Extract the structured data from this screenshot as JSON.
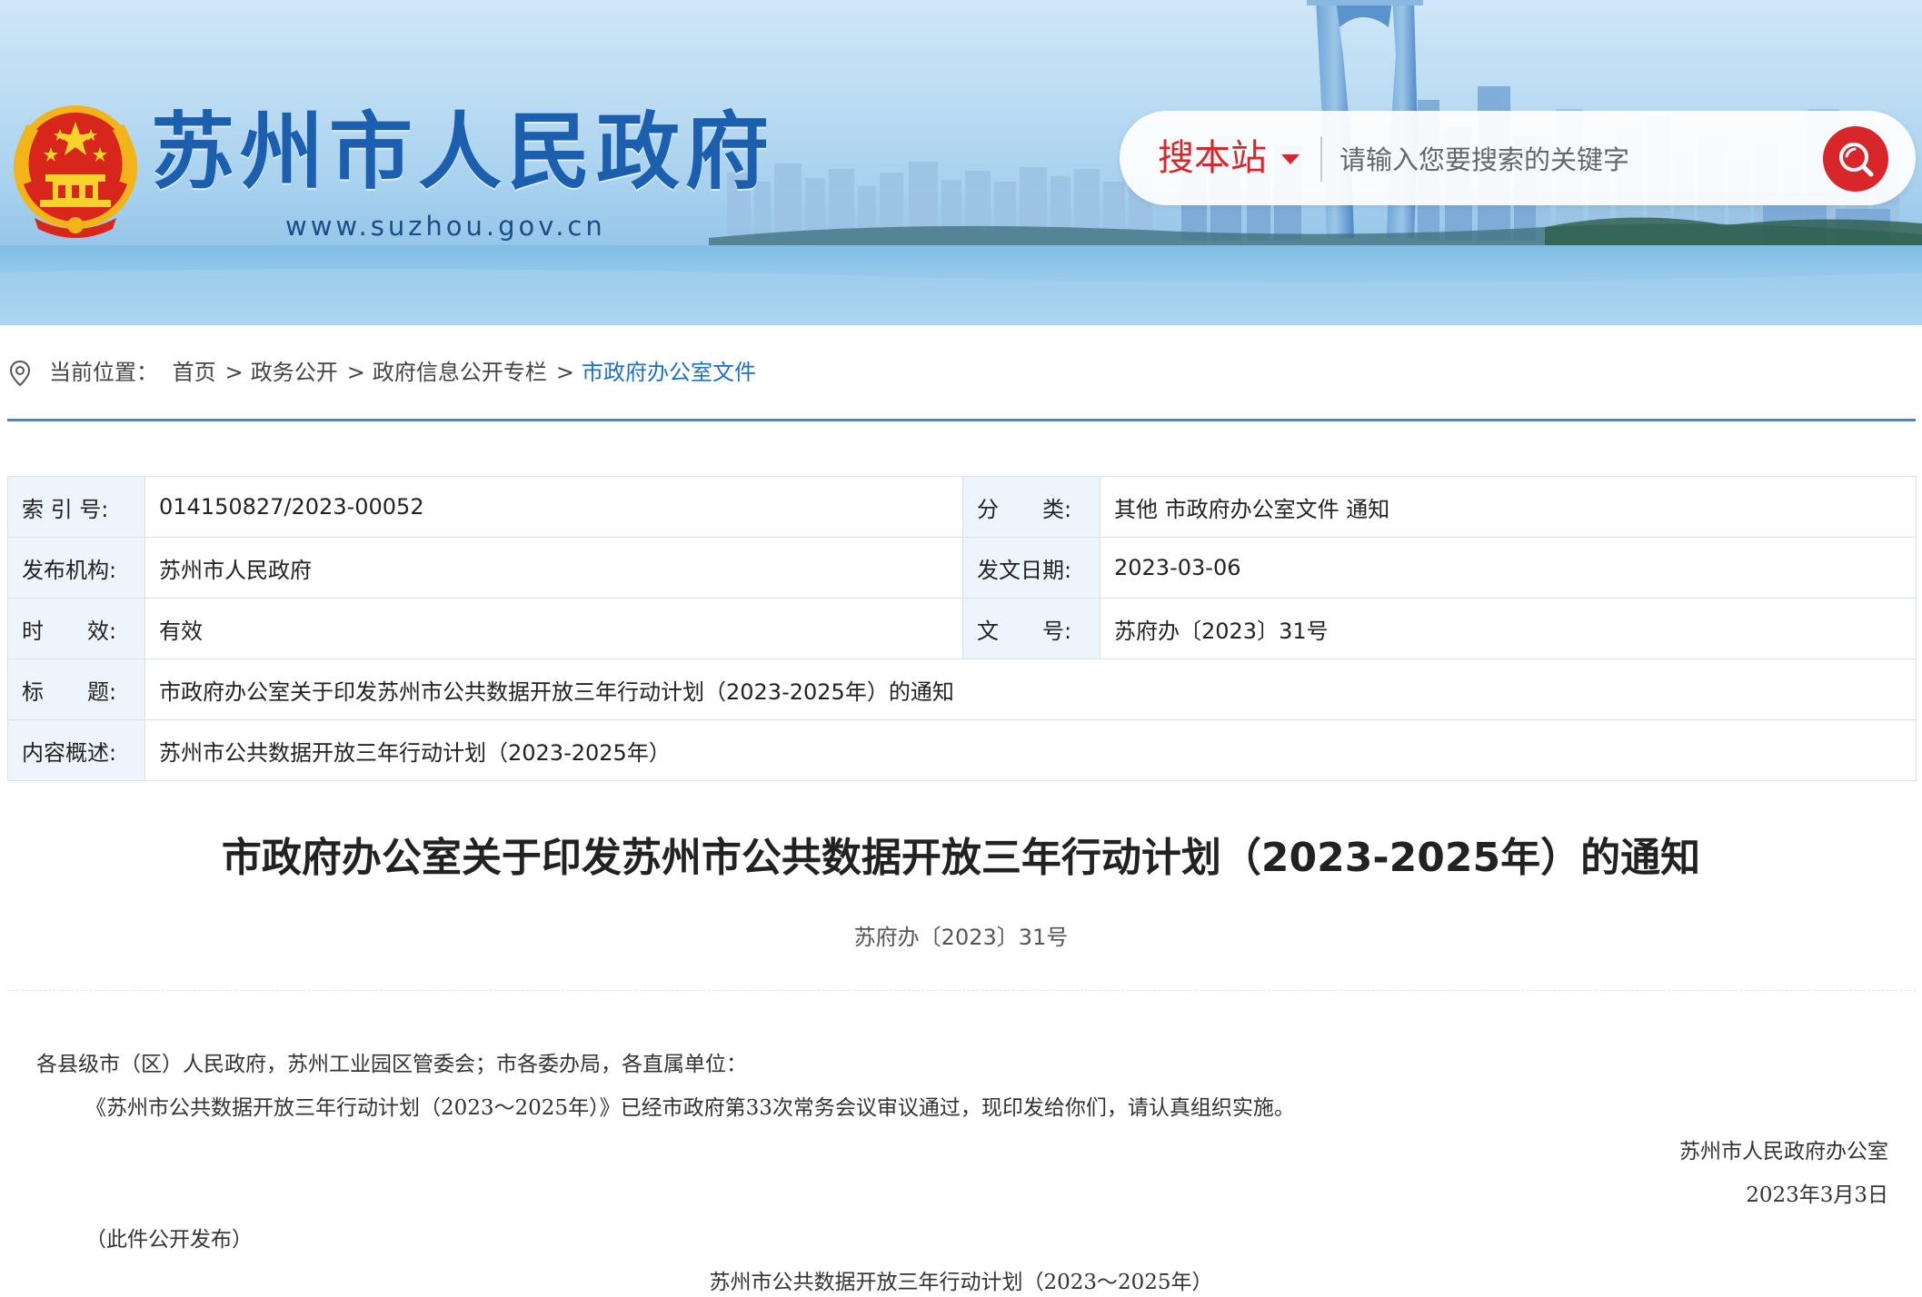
{
  "header": {
    "site_title": "苏州市人民政府",
    "site_url": "www.suzhou.gov.cn",
    "search": {
      "scope_label": "搜本站",
      "placeholder": "请输入您要搜索的关键字"
    }
  },
  "breadcrumb": {
    "prefix": "当前位置：",
    "items": [
      "首页",
      "政务公开",
      "政府信息公开专栏"
    ],
    "separator": ">",
    "current": "市政府办公室文件"
  },
  "info_table": {
    "index_no_label": "索 引 号:",
    "index_no": "014150827/2023-00052",
    "category_label": "分　　类:",
    "category": "其他 市政府办公室文件 通知",
    "publisher_label": "发布机构:",
    "publisher": "苏州市人民政府",
    "issue_date_label": "发文日期:",
    "issue_date": "2023-03-06",
    "validity_label": "时　　效:",
    "validity": "有效",
    "doc_no_label": "文　　号:",
    "doc_no": "苏府办〔2023〕31号",
    "title_label": "标　　题:",
    "title": "市政府办公室关于印发苏州市公共数据开放三年行动计划（2023-2025年）的通知",
    "summary_label": "内容概述:",
    "summary": "苏州市公共数据开放三年行动计划（2023-2025年）"
  },
  "article": {
    "title": "市政府办公室关于印发苏州市公共数据开放三年行动计划（2023-2025年）的通知",
    "doc_no": "苏府办〔2023〕31号",
    "addressee": "各县级市（区）人民政府，苏州工业园区管委会；市各委办局，各直属单位：",
    "body": "《苏州市公共数据开放三年行动计划（2023～2025年）》已经市政府第33次常务会议审议通过，现印发给你们，请认真组织实施。",
    "signature": "苏州市人民政府办公室",
    "date": "2023年3月3日",
    "publish_note": "（此件公开发布）",
    "attachment_title": "苏州市公共数据开放三年行动计划（2023～2025年）"
  },
  "colors": {
    "brand_blue": "#1b5fae",
    "accent_red": "#d8262b",
    "link_blue": "#1e6fc9",
    "rule_blue": "#3f87d9"
  },
  "icons": [
    "national-emblem-icon",
    "search-icon",
    "location-pin-icon",
    "caret-down-icon"
  ]
}
